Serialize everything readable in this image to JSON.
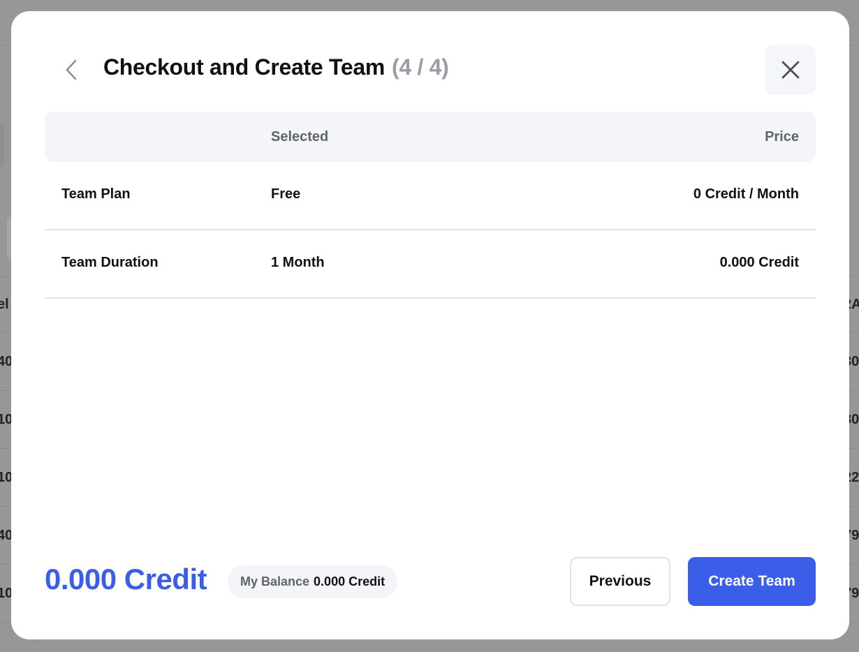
{
  "background": {
    "left_cells": [
      "el",
      "40",
      "10",
      "10",
      "40",
      "10"
    ],
    "right_cells": [
      "2A",
      "30",
      "30",
      "22",
      "79",
      "79"
    ]
  },
  "modal": {
    "title": "Checkout and Create Team",
    "step": "(4 / 4)",
    "back_icon": "chevron-left-icon",
    "close_icon": "close-icon",
    "table": {
      "columns": [
        "",
        "Selected",
        "Price"
      ],
      "rows": [
        {
          "item": "Team Plan",
          "selected": "Free",
          "price": "0 Credit / Month"
        },
        {
          "item": "Team Duration",
          "selected": "1 Month",
          "price": "0.000 Credit"
        }
      ]
    },
    "footer": {
      "total": "0.000 Credit",
      "balance_label": "My Balance",
      "balance_value": "0.000 Credit",
      "previous_label": "Previous",
      "create_label": "Create Team"
    }
  },
  "colors": {
    "accent": "#3b5ee9",
    "muted_text": "#9a9ca8",
    "header_bg": "#f4f5f9",
    "overlay": "#979797"
  }
}
